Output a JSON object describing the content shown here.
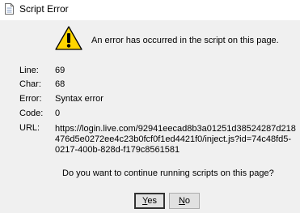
{
  "window": {
    "title": "Script Error",
    "title_icon": "document-icon"
  },
  "dialog": {
    "icon": "warning-icon",
    "message": "An error has occurred in the script on this page.",
    "fields": {
      "line": {
        "label": "Line:",
        "value": "69"
      },
      "char": {
        "label": "Char:",
        "value": "68"
      },
      "error": {
        "label": "Error:",
        "value": "Syntax error"
      },
      "code": {
        "label": "Code:",
        "value": "0"
      },
      "url": {
        "label": "URL:",
        "lines": [
          "https://login.live.com/92941eecad8b3a01251d38524287d218",
          "476d5e0272ee4c23b0fcf0f1ed4421f0/inject.js?id=74c48fd5-",
          "0217-400b-828d-f179c8561581"
        ]
      }
    },
    "question": "Do you want to continue running scripts on this page?",
    "buttons": {
      "yes": {
        "accel": "Y",
        "rest": "es"
      },
      "no": {
        "accel": "N",
        "rest": "o"
      }
    }
  }
}
